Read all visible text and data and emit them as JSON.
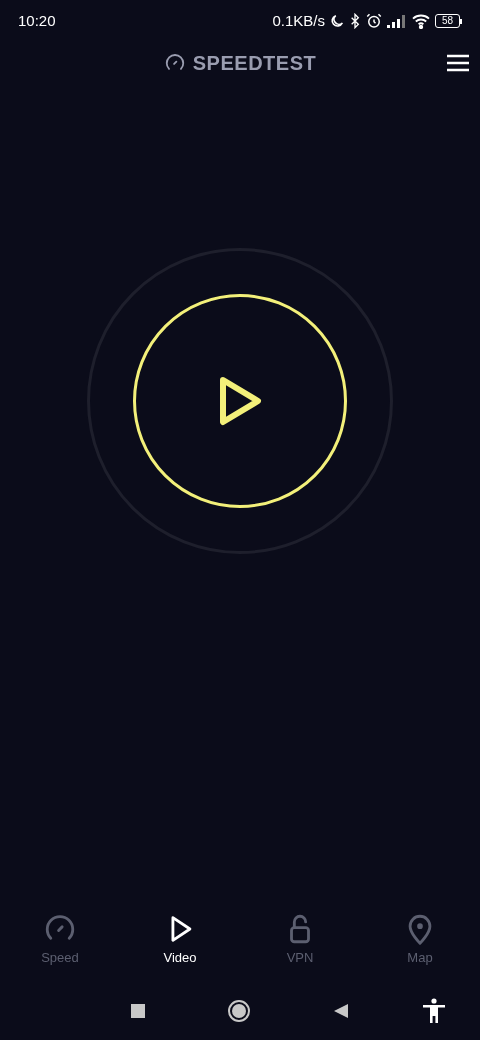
{
  "status_bar": {
    "time": "10:20",
    "network_speed": "0.1KB/s",
    "battery": "58"
  },
  "header": {
    "title": "SPEEDTEST"
  },
  "tabs": [
    {
      "kind": "speed",
      "label": "Speed",
      "selected": false
    },
    {
      "kind": "video",
      "label": "Video",
      "selected": true
    },
    {
      "kind": "vpn",
      "label": "VPN",
      "selected": false
    },
    {
      "kind": "map",
      "label": "Map",
      "selected": false
    }
  ]
}
